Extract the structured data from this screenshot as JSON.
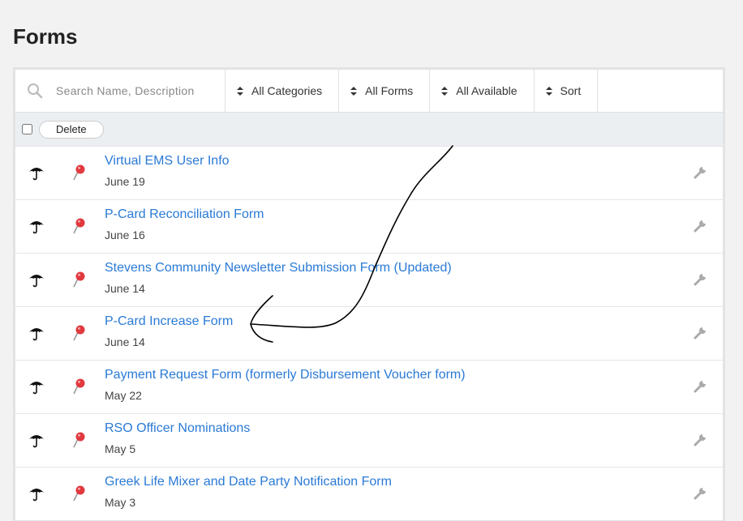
{
  "page": {
    "title": "Forms"
  },
  "toolbar": {
    "search_placeholder": "Search Name, Description",
    "filters": [
      {
        "label": "All Categories"
      },
      {
        "label": "All Forms"
      },
      {
        "label": "All Available"
      },
      {
        "label": "Sort"
      }
    ]
  },
  "actions": {
    "delete_label": "Delete"
  },
  "forms": [
    {
      "title": "Virtual EMS User Info",
      "date": "June 19"
    },
    {
      "title": "P-Card Reconciliation Form",
      "date": "June 16"
    },
    {
      "title": "Stevens Community Newsletter Submission Form (Updated)",
      "date": "June 14"
    },
    {
      "title": "P-Card Increase Form",
      "date": "June 14"
    },
    {
      "title": "Payment Request Form (formerly Disbursement Voucher form)",
      "date": "May 22"
    },
    {
      "title": "RSO Officer Nominations",
      "date": "May 5"
    },
    {
      "title": "Greek Life Mixer and Date Party Notification Form",
      "date": "May 3"
    }
  ],
  "icons": {
    "row_left": "umbrella-icon",
    "row_pin": "pushpin-icon",
    "row_action": "wrench-icon",
    "search": "search-icon",
    "filter": "sort-arrows-icon"
  },
  "colors": {
    "link": "#2a7ad6",
    "pin": "#e0393e",
    "toolbar_bg": "#eceff2"
  }
}
